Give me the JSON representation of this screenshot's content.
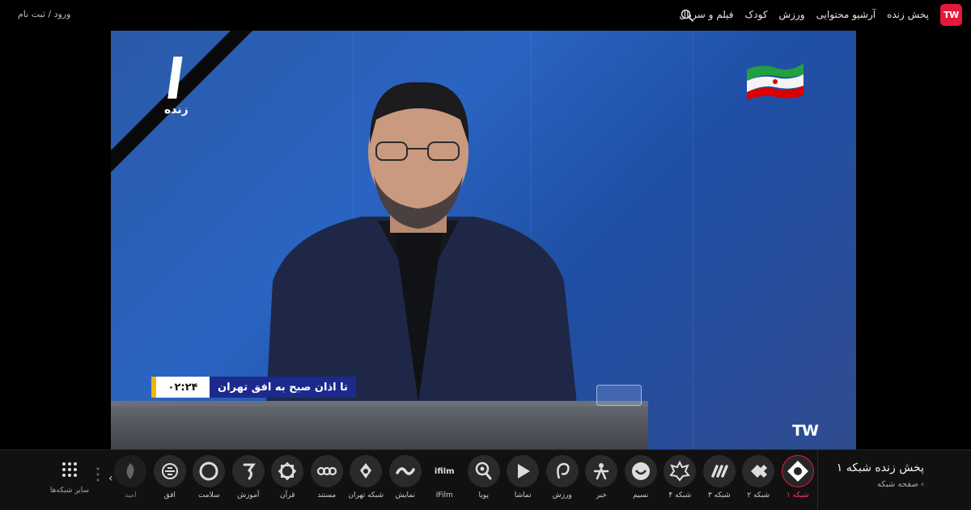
{
  "header": {
    "logo_text": "TW",
    "nav": [
      "پخش زنده",
      "آرشیو محتوایی",
      "ورزش",
      "کودک",
      "فیلم و سریال"
    ],
    "login": "ورود / ثبت نام",
    "icons": {
      "search": "search-icon"
    }
  },
  "player": {
    "badge_text": "زنده",
    "ticker_text": "تا اذان صبح به افق تهران",
    "ticker_time": "۰۲:۲۴",
    "watermark": "TW",
    "accent_color": "#e5183c"
  },
  "now_playing": {
    "title": "پخش زنده شبکه ۱",
    "link": "صفحه شبکه"
  },
  "channels": [
    {
      "label": "شبکه ۱",
      "active": true
    },
    {
      "label": "شبکه ۲"
    },
    {
      "label": "شبکه ۳"
    },
    {
      "label": "شبکه ۴"
    },
    {
      "label": "نسیم"
    },
    {
      "label": "خبر"
    },
    {
      "label": "ورزش"
    },
    {
      "label": "تماشا"
    },
    {
      "label": "پویا"
    },
    {
      "label": "IFilm",
      "icon_text": "ifilm"
    },
    {
      "label": "نمایش"
    },
    {
      "label": "شبکه تهران"
    },
    {
      "label": "مستند"
    },
    {
      "label": "قرآن"
    },
    {
      "label": "آموزش"
    },
    {
      "label": "سلامت"
    },
    {
      "label": "افق"
    },
    {
      "label": "امید",
      "dim": true
    }
  ],
  "all_networks_label": "سایر شبکه‌ها"
}
